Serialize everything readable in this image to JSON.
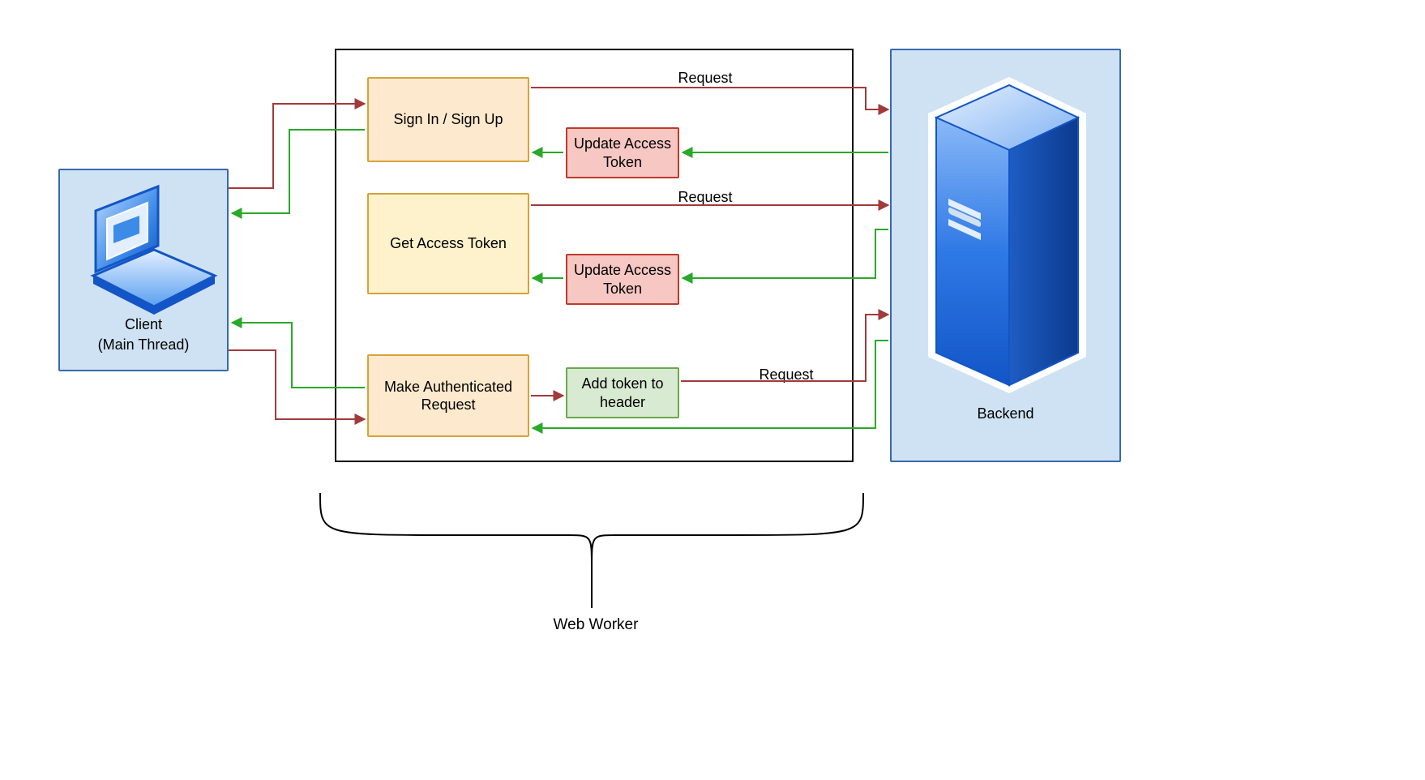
{
  "client": {
    "label_line1": "Client",
    "label_line2": "(Main Thread)"
  },
  "backend": {
    "label": "Backend"
  },
  "web_worker_label": "Web Worker",
  "worker_boxes": {
    "signin": "Sign In / Sign Up",
    "update_token_1": "Update Access Token",
    "get_token": "Get Access Token",
    "update_token_2": "Update Access Token",
    "make_auth_request": "Make Authenticated Request",
    "add_token_header": "Add token to header"
  },
  "arrow_labels": {
    "request1": "Request",
    "request2": "Request",
    "request3": "Request"
  },
  "colors": {
    "red_line": "#a13a3a",
    "green_line": "#2aa82a",
    "black_line": "#000000",
    "blue_grad_light": "#e3efff",
    "blue_grad_mid": "#5aa0f0",
    "blue_grad_dark": "#1255c6"
  }
}
